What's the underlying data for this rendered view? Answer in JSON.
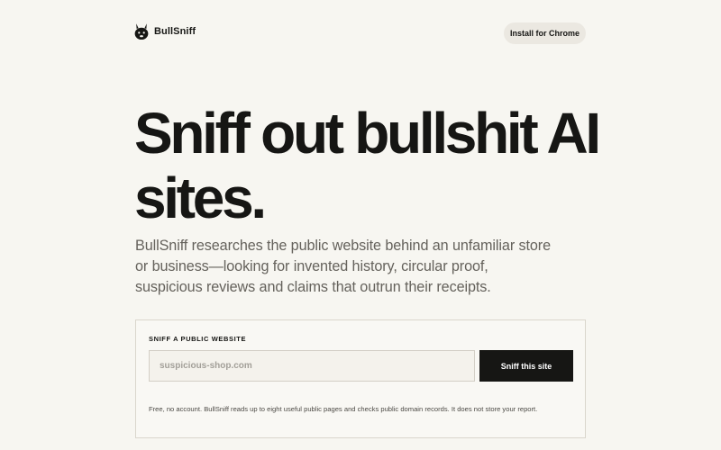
{
  "brand": {
    "name": "BullSniff",
    "logo_icon": "bull-head-icon"
  },
  "header": {
    "install_label": "Install for Chrome"
  },
  "hero": {
    "title": "Sniff out bullshit AI sites.",
    "lead": "BullSniff researches the public website behind an unfamiliar store or business—looking for invented history, circular proof, suspicious reviews and claims that outrun their receipts."
  },
  "sniff_form": {
    "label": "SNIFF A PUBLIC WEBSITE",
    "input_value": "",
    "input_placeholder": "suspicious-shop.com",
    "submit_label": "Sniff this site",
    "note": "Free, no account. BullSniff reads up to eight useful public pages and checks public domain records. It does not store your report."
  },
  "colors": {
    "background": "#f7f6f1",
    "text": "#161614",
    "muted": "#65625c",
    "button_dark": "#161614",
    "pill": "#ebe8e1"
  }
}
